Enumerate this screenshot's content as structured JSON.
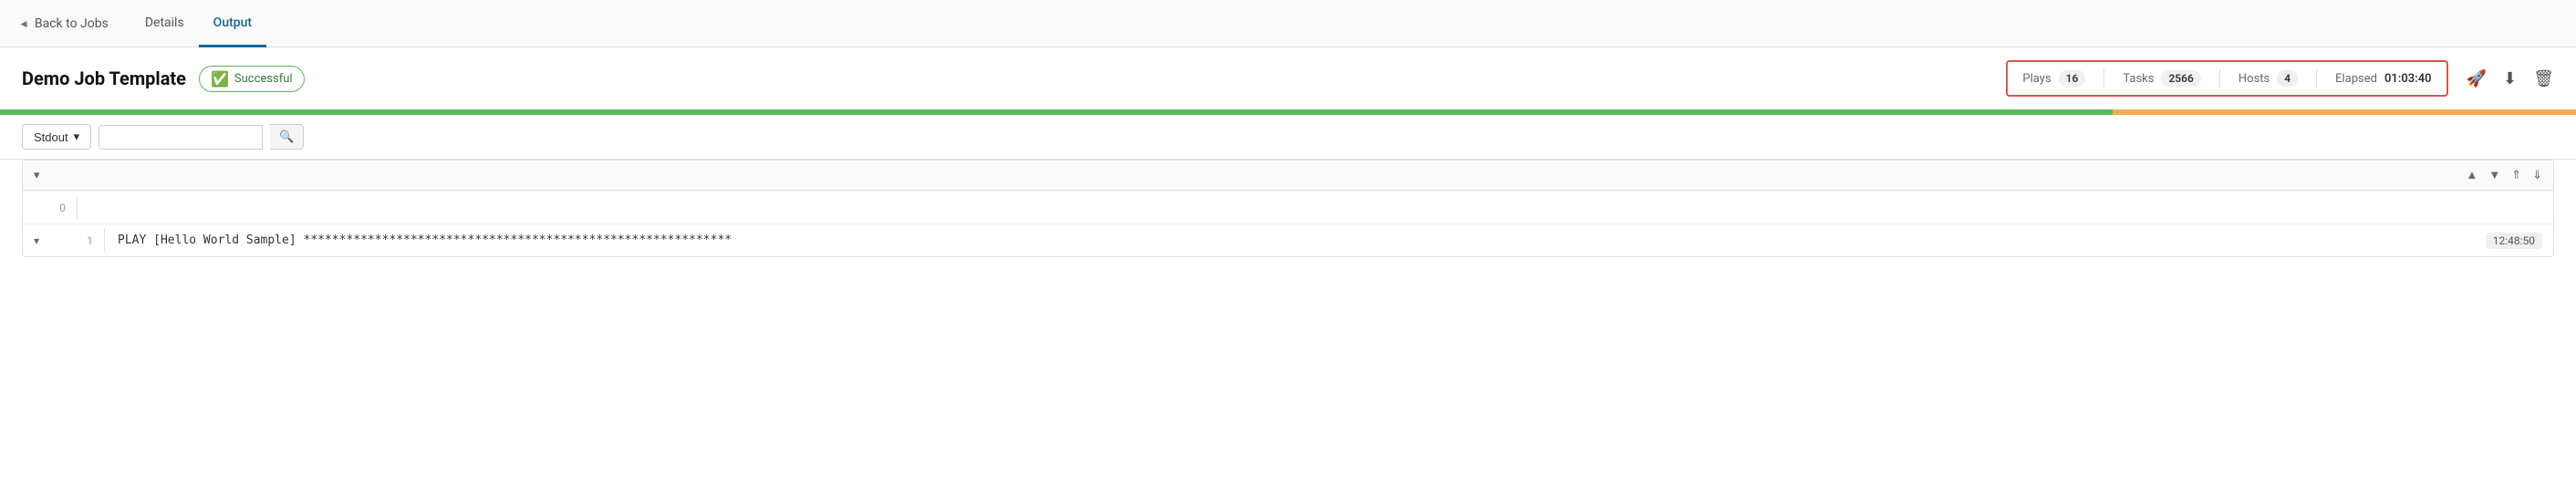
{
  "nav": {
    "back_label": "Back to Jobs",
    "tabs": [
      {
        "id": "details",
        "label": "Details",
        "active": false
      },
      {
        "id": "output",
        "label": "Output",
        "active": true
      }
    ]
  },
  "header": {
    "job_title": "Demo Job Template",
    "status_label": "Successful",
    "stats": {
      "plays_label": "Plays",
      "plays_value": "16",
      "tasks_label": "Tasks",
      "tasks_value": "2566",
      "hosts_label": "Hosts",
      "hosts_value": "4",
      "elapsed_label": "Elapsed",
      "elapsed_value": "01:03:40"
    }
  },
  "toolbar": {
    "stdout_label": "Stdout",
    "search_placeholder": ""
  },
  "output": {
    "rows": [
      {
        "number": "0",
        "content": "",
        "timestamp": "",
        "expand": false
      },
      {
        "number": "1",
        "content": "PLAY [Hello World Sample] ************************************************************",
        "timestamp": "12:48:50",
        "expand": true
      }
    ]
  },
  "icons": {
    "chevron_left": "◄",
    "chevron_down": "▾",
    "chevron_up": "▴",
    "chevron_up_double": "⇑",
    "chevron_down_double": "⇓",
    "search": "🔍",
    "rocket": "🚀",
    "download": "⬇",
    "trash": "🗑"
  },
  "colors": {
    "active_tab": "#1a6496",
    "status_green": "#5cb85c",
    "status_border": "#d9534f",
    "progress_green": "#5cb85c",
    "progress_yellow": "#f0ad4e"
  }
}
